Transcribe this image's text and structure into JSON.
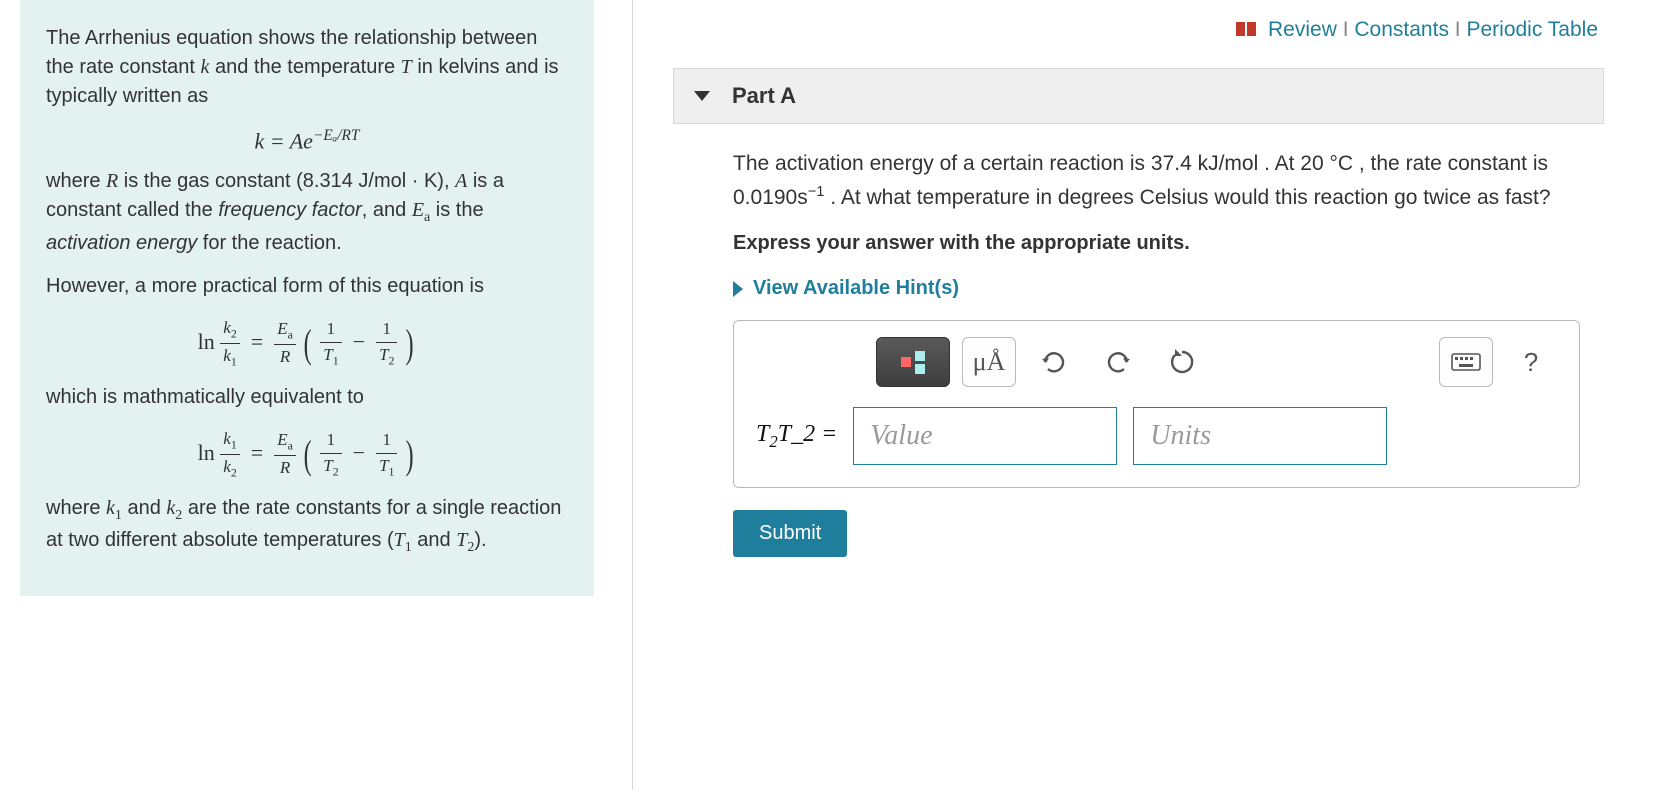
{
  "toplinks": {
    "review": "Review",
    "constants": "Constants",
    "periodic": "Periodic Table"
  },
  "intro": {
    "p1a": "The Arrhenius equation shows the relationship between the rate constant ",
    "k": "k",
    "p1b": " and the temperature ",
    "T": "T",
    "p1c": " in kelvins and is typically written as",
    "eq1": "k = Ae",
    "eq1_exp": "−Eₐ/RT",
    "p2a": "where ",
    "R": "R",
    "p2b": " is the gas constant (8.314 J/mol · K), ",
    "A": "A",
    "p2c": " is a constant called the ",
    "ff": "frequency factor",
    "p2d": ", and ",
    "Ea": "E",
    "Ea_sub": "a",
    "p2e": " is the ",
    "ae": "activation energy",
    "p2f": " for the reaction.",
    "p3": "However, a more practical form of this equation is",
    "p4": "which is mathmatically equivalent to",
    "p5a": "where ",
    "k1": "k",
    "p5b": " and ",
    "k2": "k",
    "p5c": " are the rate constants for a single reaction at two different absolute temperatures (",
    "T1": "T",
    "p5d": " and ",
    "T2": "T",
    "p5e": ")."
  },
  "part": {
    "name": "Part A",
    "q1": "The activation energy of a certain reaction is 37.4 kJ/mol . At 20 °C , the rate constant is 0.0190s",
    "q1_exp": "−1",
    "q2": " . At what temperature in degrees Celsius would this reaction go twice as fast?",
    "express": "Express your answer with the appropriate units.",
    "hints": "View Available Hint(s)"
  },
  "answer": {
    "var_html": "T₂T_2 =",
    "value_ph": "Value",
    "units_ph": "Units",
    "submit": "Submit",
    "ua": "μÅ",
    "help": "?"
  }
}
